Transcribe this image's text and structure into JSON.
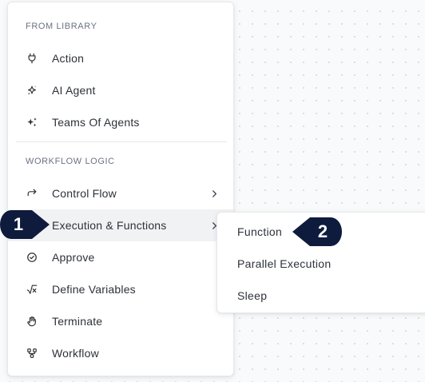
{
  "menu": {
    "sections": [
      {
        "label": "FROM LIBRARY",
        "items": [
          {
            "label": "Action",
            "icon": "plug-icon"
          },
          {
            "label": "AI Agent",
            "icon": "sparkle-star-icon"
          },
          {
            "label": "Teams Of Agents",
            "icon": "sparkles-icon"
          }
        ]
      },
      {
        "label": "WORKFLOW LOGIC",
        "items": [
          {
            "label": "Control Flow",
            "icon": "redirect-arrow-icon",
            "has_submenu": true
          },
          {
            "label": "Execution & Functions",
            "icon": "function-icon",
            "has_submenu": true,
            "active": true
          },
          {
            "label": "Approve",
            "icon": "check-circle-icon"
          },
          {
            "label": "Define Variables",
            "icon": "square-root-icon"
          },
          {
            "label": "Terminate",
            "icon": "hand-stop-icon"
          },
          {
            "label": "Workflow",
            "icon": "workflow-nodes-icon"
          }
        ]
      }
    ]
  },
  "submenu": {
    "items": [
      {
        "label": "Function"
      },
      {
        "label": "Parallel Execution"
      },
      {
        "label": "Sleep"
      }
    ]
  },
  "callouts": [
    {
      "number": "1"
    },
    {
      "number": "2"
    }
  ],
  "colors": {
    "callout": "#0f1b3d",
    "active_row": "#f1f2f4",
    "text": "#2d3139",
    "section_label": "#6b7280"
  }
}
